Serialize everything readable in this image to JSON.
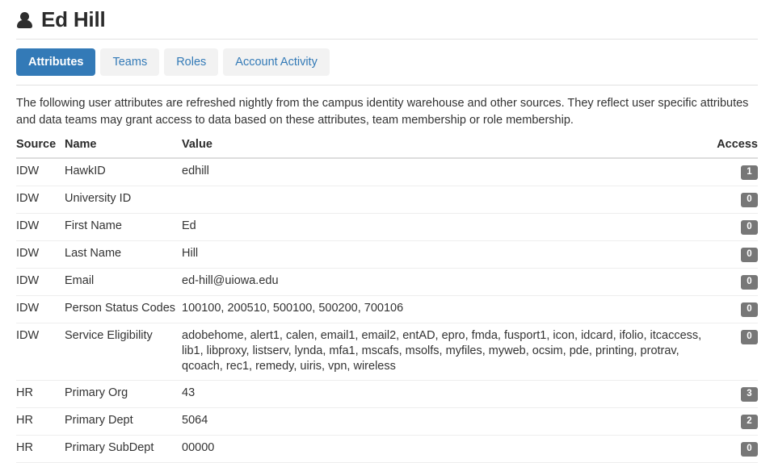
{
  "header": {
    "icon": "user-icon",
    "title": "Ed Hill"
  },
  "tabs": [
    {
      "label": "Attributes",
      "active": true
    },
    {
      "label": "Teams",
      "active": false
    },
    {
      "label": "Roles",
      "active": false
    },
    {
      "label": "Account Activity",
      "active": false
    }
  ],
  "description": "The following user attributes are refreshed nightly from the campus identity warehouse and other sources. They reflect user specific attributes and data teams may grant access to data based on these attributes, team membership or role membership.",
  "table": {
    "columns": [
      "Source",
      "Name",
      "Value",
      "Access"
    ],
    "rows": [
      {
        "source": "IDW",
        "name": "HawkID",
        "value": "edhill",
        "access": "1"
      },
      {
        "source": "IDW",
        "name": "University ID",
        "value": "",
        "access": "0"
      },
      {
        "source": "IDW",
        "name": "First Name",
        "value": "Ed",
        "access": "0"
      },
      {
        "source": "IDW",
        "name": "Last Name",
        "value": "Hill",
        "access": "0"
      },
      {
        "source": "IDW",
        "name": "Email",
        "value": "ed-hill@uiowa.edu",
        "access": "0"
      },
      {
        "source": "IDW",
        "name": "Person Status Codes",
        "value": "100100, 200510, 500100, 500200, 700106",
        "access": "0"
      },
      {
        "source": "IDW",
        "name": "Service Eligibility",
        "value": "adobehome, alert1, calen, email1, email2, entAD, epro, fmda, fusport1, icon, idcard, ifolio, itcaccess, lib1, libproxy, listserv, lynda, mfa1, mscafs, msolfs, myfiles, myweb, ocsim, pde, printing, protrav, qcoach, rec1, remedy, uiris, vpn, wireless",
        "access": "0"
      },
      {
        "source": "HR",
        "name": "Primary Org",
        "value": "43",
        "access": "3"
      },
      {
        "source": "HR",
        "name": "Primary Dept",
        "value": "5064",
        "access": "2"
      },
      {
        "source": "HR",
        "name": "Primary SubDept",
        "value": "00000",
        "access": "0"
      }
    ]
  },
  "colors": {
    "accent": "#337ab7",
    "tab_inactive_bg": "#f2f2f2",
    "badge_bg": "#777777",
    "text": "#333333",
    "rule": "#e2e2e2"
  }
}
